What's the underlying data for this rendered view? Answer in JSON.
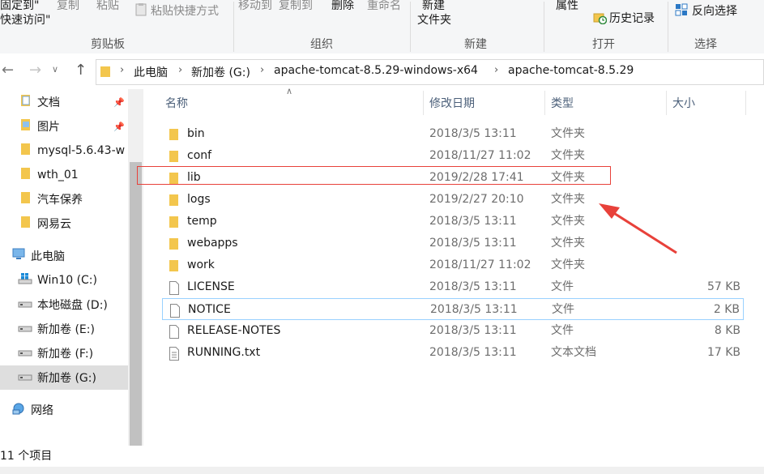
{
  "ribbon": {
    "clipboard": {
      "pin_quick_access_line1": "固定到\"",
      "pin_quick_access_line2": "快速访问\"",
      "copy": "复制",
      "paste": "粘贴",
      "paste_shortcut": "粘贴快捷方式",
      "group_label": "剪贴板"
    },
    "organize": {
      "move_to": "移动到",
      "copy_to": "复制到",
      "group_label": "组织"
    },
    "delete_rename": {
      "delete": "删除",
      "rename": "重命名"
    },
    "new": {
      "new_folder_line1": "新建",
      "new_folder_line2": "文件夹",
      "group_label": "新建"
    },
    "open": {
      "properties": "属性",
      "history": "历史记录",
      "group_label": "打开"
    },
    "select": {
      "invert": "反向选择",
      "group_label": "选择"
    }
  },
  "address": {
    "segments": [
      "此电脑",
      "新加卷 (G:)",
      "apache-tomcat-8.5.29-windows-x64",
      "apache-tomcat-8.5.29"
    ]
  },
  "nav": {
    "items": [
      {
        "label": "文档",
        "icon": "document-folder-icon",
        "pinned": true
      },
      {
        "label": "图片",
        "icon": "pictures-folder-icon",
        "pinned": true
      },
      {
        "label": "mysql-5.6.43-w",
        "icon": "folder-icon",
        "pinned": false
      },
      {
        "label": "wth_01",
        "icon": "folder-icon",
        "pinned": false
      },
      {
        "label": "汽车保养",
        "icon": "folder-icon",
        "pinned": false
      },
      {
        "label": "网易云",
        "icon": "folder-icon",
        "pinned": false
      },
      {
        "label": "此电脑",
        "icon": "computer-icon",
        "pinned": false
      },
      {
        "label": "Win10 (C:)",
        "icon": "windows-drive-icon",
        "pinned": false
      },
      {
        "label": "本地磁盘 (D:)",
        "icon": "drive-icon",
        "pinned": false
      },
      {
        "label": "新加卷 (E:)",
        "icon": "drive-icon",
        "pinned": false
      },
      {
        "label": "新加卷 (F:)",
        "icon": "drive-icon",
        "pinned": false
      },
      {
        "label": "新加卷 (G:)",
        "icon": "drive-icon",
        "pinned": false
      },
      {
        "label": "网络",
        "icon": "network-icon",
        "pinned": false
      }
    ]
  },
  "columns": {
    "name": "名称",
    "date": "修改日期",
    "type": "类型",
    "size": "大小"
  },
  "files": [
    {
      "name": "bin",
      "date": "2018/3/5 13:11",
      "type": "文件夹",
      "size": "",
      "kind": "folder"
    },
    {
      "name": "conf",
      "date": "2018/11/27 11:02",
      "type": "文件夹",
      "size": "",
      "kind": "folder"
    },
    {
      "name": "lib",
      "date": "2019/2/28 17:41",
      "type": "文件夹",
      "size": "",
      "kind": "folder"
    },
    {
      "name": "logs",
      "date": "2019/2/27 20:10",
      "type": "文件夹",
      "size": "",
      "kind": "folder"
    },
    {
      "name": "temp",
      "date": "2018/3/5 13:11",
      "type": "文件夹",
      "size": "",
      "kind": "folder"
    },
    {
      "name": "webapps",
      "date": "2018/3/5 13:11",
      "type": "文件夹",
      "size": "",
      "kind": "folder"
    },
    {
      "name": "work",
      "date": "2018/11/27 11:02",
      "type": "文件夹",
      "size": "",
      "kind": "folder"
    },
    {
      "name": "LICENSE",
      "date": "2018/3/5 13:11",
      "type": "文件",
      "size": "57 KB",
      "kind": "file"
    },
    {
      "name": "NOTICE",
      "date": "2018/3/5 13:11",
      "type": "文件",
      "size": "2 KB",
      "kind": "file"
    },
    {
      "name": "RELEASE-NOTES",
      "date": "2018/3/5 13:11",
      "type": "文件",
      "size": "8 KB",
      "kind": "file"
    },
    {
      "name": "RUNNING.txt",
      "date": "2018/3/5 13:11",
      "type": "文本文档",
      "size": "17 KB",
      "kind": "text"
    }
  ],
  "status": {
    "item_count": "11 个项目"
  },
  "colors": {
    "highlight_box": "#e8413a",
    "arrow": "#e8413a",
    "hover_border": "#99d1ff",
    "folder": "#f3c64d"
  }
}
